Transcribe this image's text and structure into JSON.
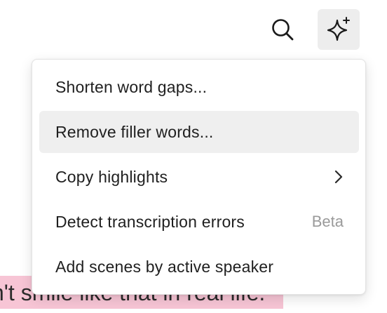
{
  "toolbar": {
    "search_icon": "search-icon",
    "ai_icon": "sparkle-plus-icon"
  },
  "menu": {
    "items": [
      {
        "label": "Shorten word gaps..."
      },
      {
        "label": "Remove filler words..."
      },
      {
        "label": "Copy highlights",
        "icon": "chevron-right-icon"
      },
      {
        "label": "Detect transcription errors",
        "badge": "Beta"
      },
      {
        "label": "Add scenes by active speaker"
      }
    ]
  },
  "transcript": {
    "visible_text": "n't smile like that in real life."
  },
  "colors": {
    "highlight_row": "#efefef",
    "ai_button_bg": "#ededed",
    "transcript_highlight": "#f7c5d5",
    "badge_text": "#9a9a9a"
  }
}
